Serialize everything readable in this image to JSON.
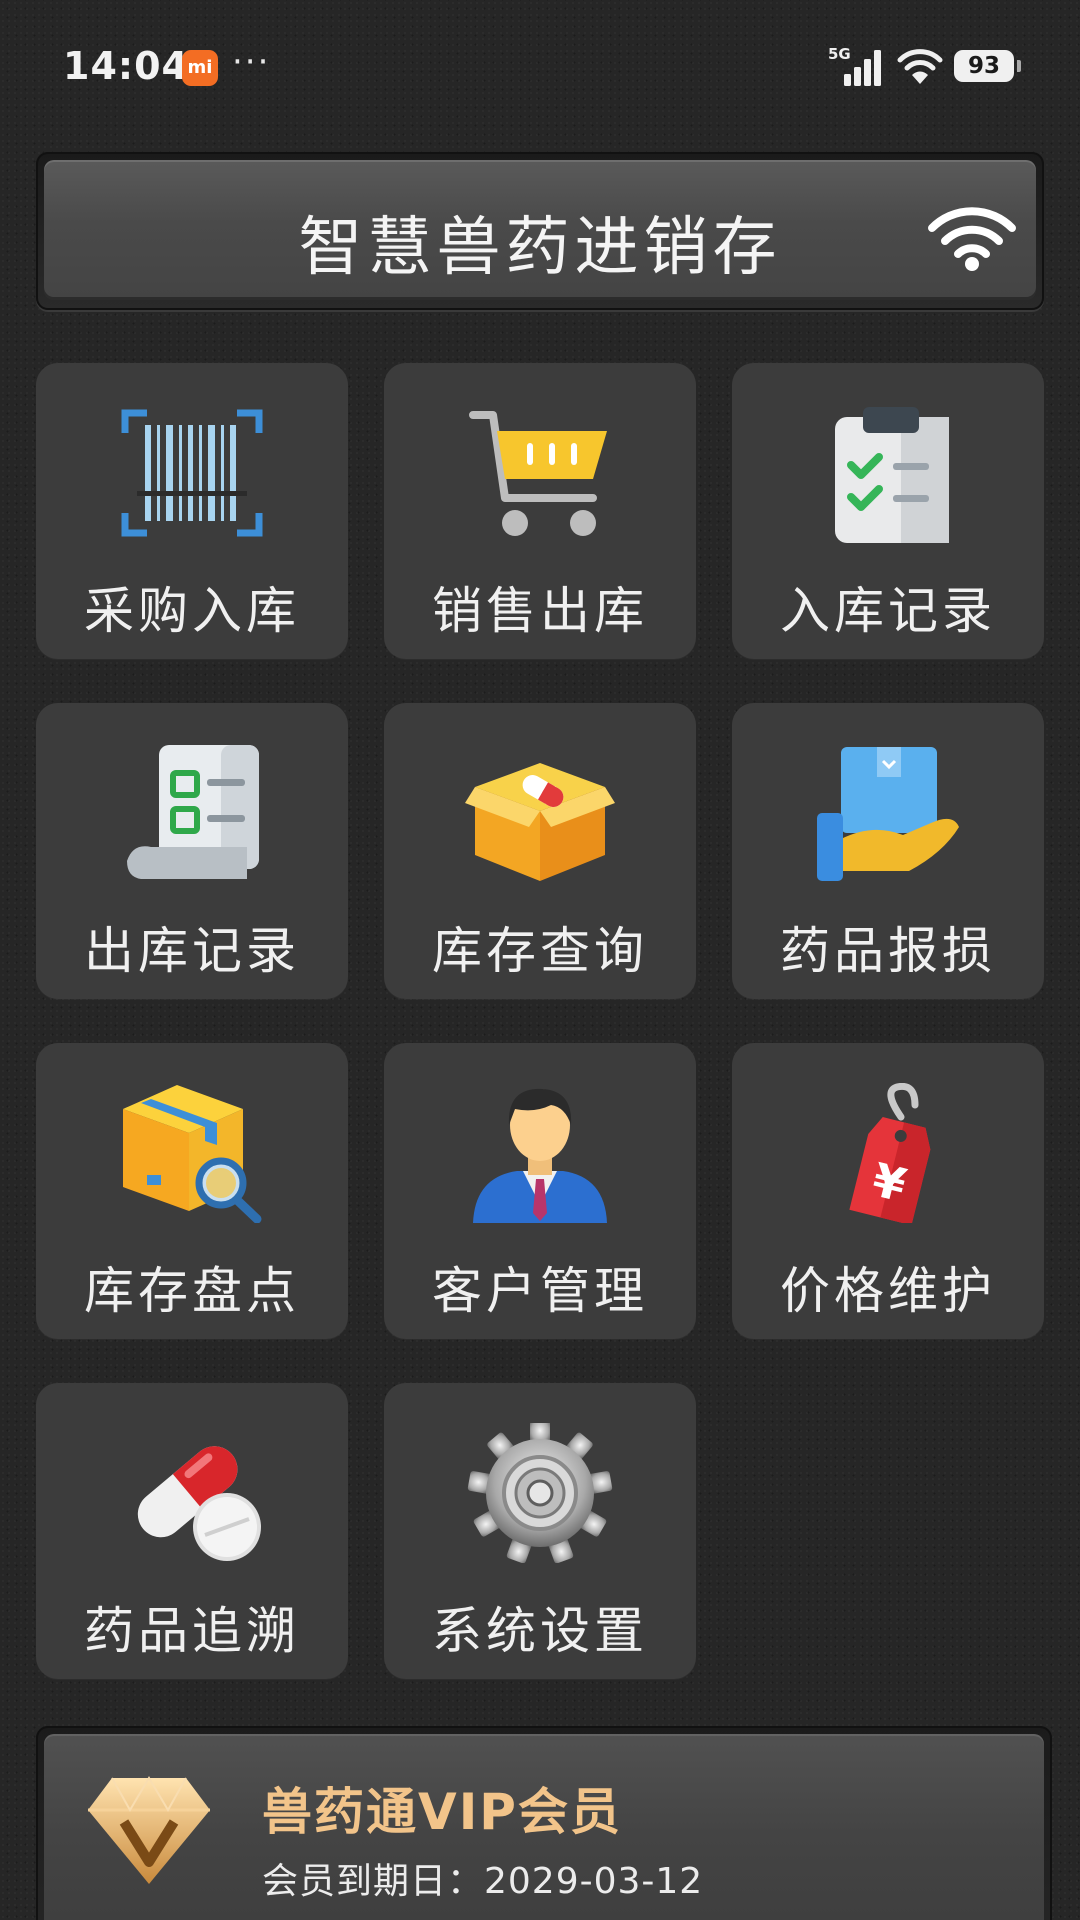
{
  "status_bar": {
    "time": "14:04",
    "carrier_badge": "mi",
    "more": "···",
    "network": "5G",
    "battery": "93"
  },
  "header": {
    "title": "智慧兽药进销存",
    "icon": "wifi-icon"
  },
  "menu": [
    {
      "label": "采购入库",
      "icon": "barcode-scan-icon"
    },
    {
      "label": "销售出库",
      "icon": "shopping-cart-icon"
    },
    {
      "label": "入库记录",
      "icon": "clipboard-checklist-icon"
    },
    {
      "label": "出库记录",
      "icon": "receipt-list-icon"
    },
    {
      "label": "库存查询",
      "icon": "medicine-box-icon"
    },
    {
      "label": "药品报损",
      "icon": "box-in-hand-icon"
    },
    {
      "label": "库存盘点",
      "icon": "box-magnifier-icon"
    },
    {
      "label": "客户管理",
      "icon": "customer-person-icon"
    },
    {
      "label": "价格维护",
      "icon": "price-tag-yen-icon"
    },
    {
      "label": "药品追溯",
      "icon": "pills-icon"
    },
    {
      "label": "系统设置",
      "icon": "gear-icon"
    }
  ],
  "vip": {
    "title": "兽药通VIP会员",
    "expiry": "会员到期日：2029-03-12",
    "icon": "diamond-v-icon"
  },
  "colors": {
    "background": "#262626",
    "tile": "#3c3c3c",
    "vip_title": "#f2c48a",
    "mi_badge": "#f36d23"
  }
}
